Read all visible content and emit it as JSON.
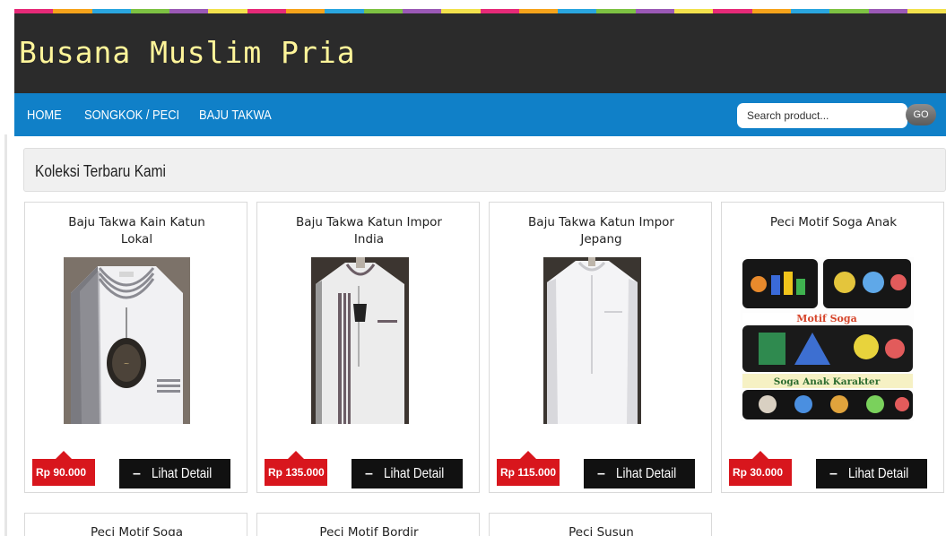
{
  "site": {
    "title": "Busana Muslim Pria",
    "accent_colors": [
      "#e62a78",
      "#f6a31b",
      "#2aa6df",
      "#7dc243",
      "#9b59b6",
      "#f2e14c"
    ]
  },
  "nav": {
    "items": [
      "HOME",
      "SONGKOK / PECI",
      "BAJU TAKWA"
    ],
    "search_placeholder": "Search product...",
    "search_value": "",
    "go_label": "GO"
  },
  "section": {
    "title": "Koleksi Terbaru Kami"
  },
  "products": [
    {
      "name": "Baju Takwa Kain Katun Lokal",
      "price": "Rp 90.000",
      "button": "Lihat Detail",
      "image": "white-koko-shirt-grey-collar"
    },
    {
      "name": "Baju Takwa Katun Impor India",
      "price": "Rp 135.000",
      "button": "Lihat Detail",
      "image": "white-koko-shirt-striped-panel"
    },
    {
      "name": "Baju Takwa Katun Impor Jepang",
      "price": "Rp 115.000",
      "button": "Lihat Detail",
      "image": "plain-white-koko-shirt"
    },
    {
      "name": "Peci Motif Soga Anak",
      "price": "Rp 30.000",
      "button": "Lihat Detail",
      "image": "kids-peci-collage"
    }
  ],
  "products_row2": [
    {
      "name": "Peci Motif Soga"
    },
    {
      "name": "Peci Motif Bordir"
    },
    {
      "name": "Peci Susun"
    }
  ],
  "collage": {
    "caption_top": "Motif Soga",
    "caption_bottom": "Soga Anak Karakter"
  },
  "colors": {
    "header_bg": "#2b2b2b",
    "title_text": "#fff59a",
    "nav_bg": "#1080c8",
    "price_badge": "#d8161d",
    "detail_button": "#111111"
  }
}
